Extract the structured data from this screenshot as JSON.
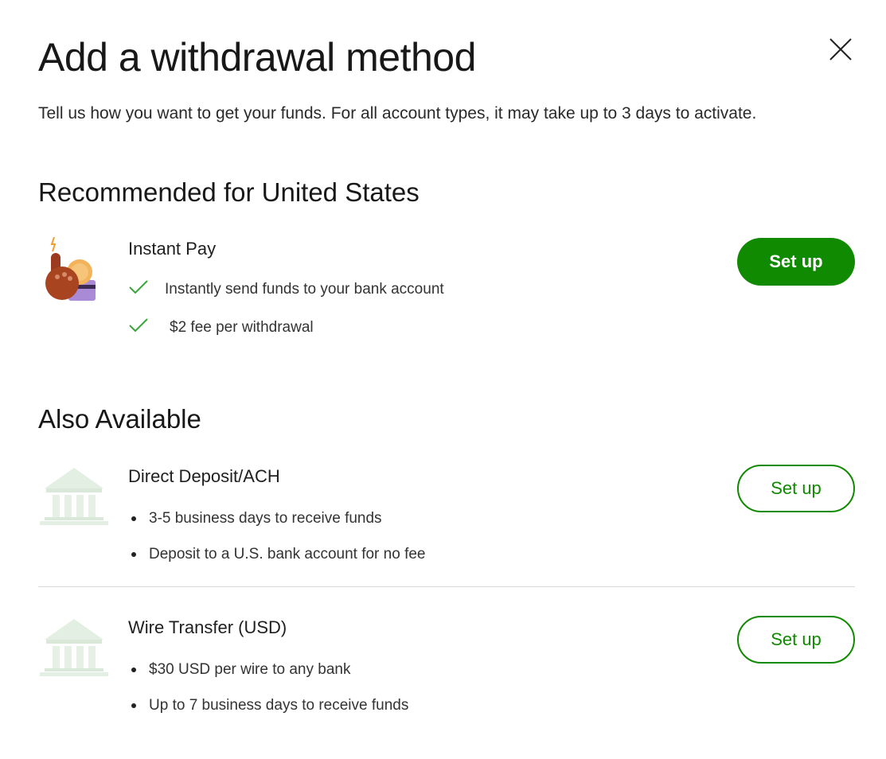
{
  "modal": {
    "title": "Add a withdrawal method",
    "subtitle": "Tell us how you want to get your funds. For all account types, it may take up to 3 days to activate."
  },
  "recommended": {
    "heading": "Recommended for United States",
    "method": {
      "title": "Instant Pay",
      "icon": "instant-pay-illustration",
      "features": [
        "Instantly send funds to your bank account",
        "$2 fee per withdrawal"
      ],
      "button_label": "Set up"
    }
  },
  "also_available": {
    "heading": "Also Available",
    "methods": [
      {
        "title": "Direct Deposit/ACH",
        "icon": "bank-icon",
        "features": [
          "3-5 business days to receive funds",
          "Deposit to a U.S. bank account for no fee"
        ],
        "button_label": "Set up"
      },
      {
        "title": "Wire Transfer (USD)",
        "icon": "bank-icon",
        "features": [
          "$30 USD per wire to any bank",
          "Up to 7 business days to receive funds"
        ],
        "button_label": "Set up"
      }
    ]
  },
  "colors": {
    "accent": "#108a00",
    "check": "#3aa63a",
    "divider": "#d9d9d9"
  }
}
